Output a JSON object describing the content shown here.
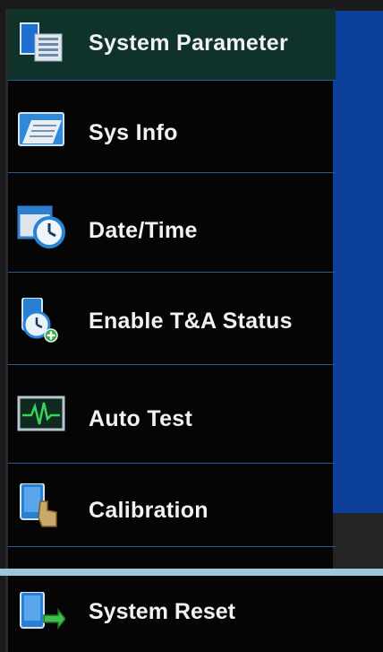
{
  "menu": {
    "items": [
      {
        "label": "System Parameter",
        "icon": "system-parameter-icon",
        "selected": true
      },
      {
        "label": "Sys Info",
        "icon": "sys-info-icon"
      },
      {
        "label": "Date/Time",
        "icon": "date-time-icon"
      },
      {
        "label": "Enable T&A Status",
        "icon": "enable-ta-status-icon"
      },
      {
        "label": "Auto Test",
        "icon": "auto-test-icon"
      },
      {
        "label": "Calibration",
        "icon": "calibration-icon"
      }
    ],
    "reset": {
      "label": "System Reset",
      "icon": "system-reset-icon"
    }
  },
  "colors": {
    "selected_bg": "#0f332b",
    "divider": "#1e5d9a",
    "side_panel": "#0b3f9a",
    "separator": "#9fc4dd"
  }
}
